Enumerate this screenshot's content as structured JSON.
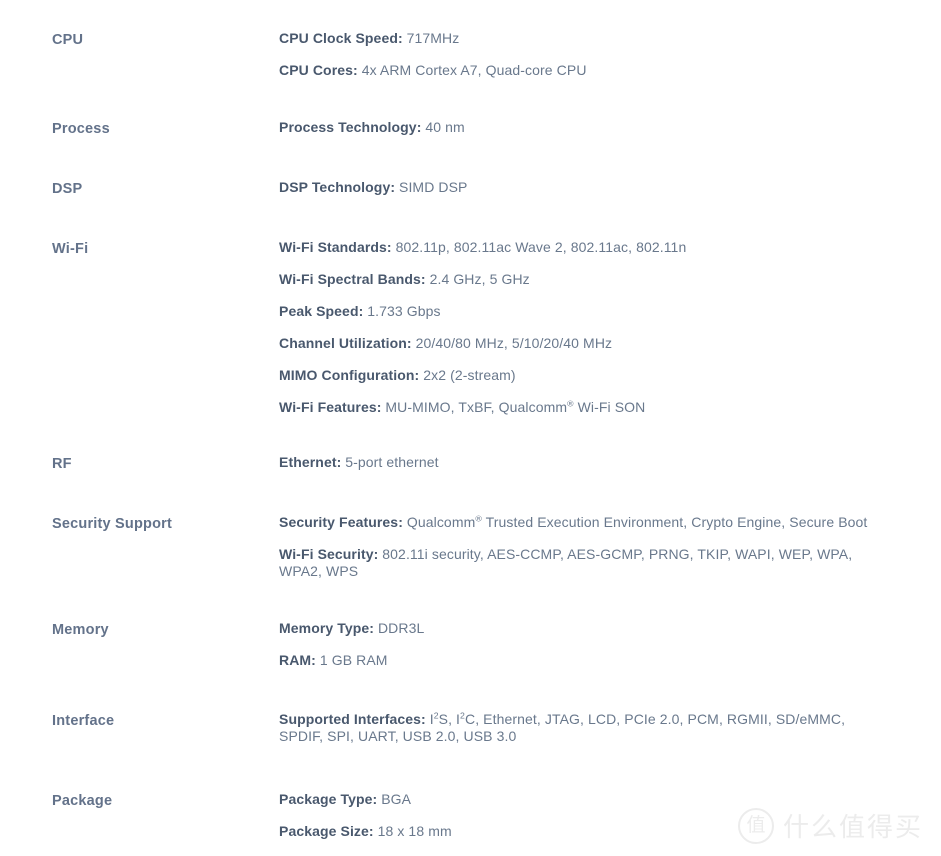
{
  "document": {
    "type": "product-specification-sheet",
    "background_color": "#ffffff",
    "label_color": "#63728a",
    "key_color": "#49586d",
    "value_color": "#69788c"
  },
  "groups": [
    {
      "label": "CPU",
      "rows": [
        {
          "key": "CPU Clock Speed:",
          "value": "717MHz"
        },
        {
          "key": "CPU Cores:",
          "value": "4x ARM Cortex A7, Quad-core CPU"
        }
      ]
    },
    {
      "label": "Process",
      "rows": [
        {
          "key": "Process Technology:",
          "value": "40 nm"
        }
      ]
    },
    {
      "label": "DSP",
      "rows": [
        {
          "key": "DSP Technology:",
          "value": "SIMD DSP"
        }
      ]
    },
    {
      "label": "Wi-Fi",
      "rows": [
        {
          "key": "Wi-Fi Standards:",
          "value": "802.11p, 802.11ac Wave 2, 802.11ac, 802.11n"
        },
        {
          "key": "Wi-Fi Spectral Bands:",
          "value": "2.4 GHz, 5 GHz"
        },
        {
          "key": "Peak Speed:",
          "value": "1.733 Gbps"
        },
        {
          "key": "Channel Utilization:",
          "value": "20/40/80 MHz, 5/10/20/40 MHz"
        },
        {
          "key": "MIMO Configuration:",
          "value": "2x2 (2-stream)"
        },
        {
          "key": "Wi-Fi Features:",
          "value": "MU-MIMO, TxBF, Qualcomm® Wi-Fi SON"
        }
      ]
    },
    {
      "label": "RF",
      "rows": [
        {
          "key": "Ethernet:",
          "value": "5-port ethernet"
        }
      ]
    },
    {
      "label": "Security Support",
      "rows": [
        {
          "key": "Security Features:",
          "value": "Qualcomm® Trusted Execution Environment, Crypto Engine, Secure Boot"
        },
        {
          "key": "Wi-Fi Security:",
          "value": "802.11i security, AES-CCMP, AES-GCMP, PRNG, TKIP, WAPI, WEP, WPA, WPA2, WPS"
        }
      ]
    },
    {
      "label": "Memory",
      "rows": [
        {
          "key": "Memory Type:",
          "value": "DDR3L"
        },
        {
          "key": "RAM:",
          "value": "1 GB RAM"
        }
      ]
    },
    {
      "label": "Interface",
      "rows": [
        {
          "key": "Supported Interfaces:",
          "value": "I²S, I²C, Ethernet, JTAG, LCD, PCIe 2.0, PCM, RGMII, SD/eMMC, SPDIF, SPI, UART, USB 2.0, USB 3.0"
        }
      ]
    },
    {
      "label": "Package",
      "rows": [
        {
          "key": "Package Type:",
          "value": "BGA"
        },
        {
          "key": "Package Size:",
          "value": "18 x 18 mm"
        }
      ]
    }
  ],
  "watermark": {
    "badge_glyph": "值",
    "text": "什么值得买",
    "color": "#ececec"
  }
}
